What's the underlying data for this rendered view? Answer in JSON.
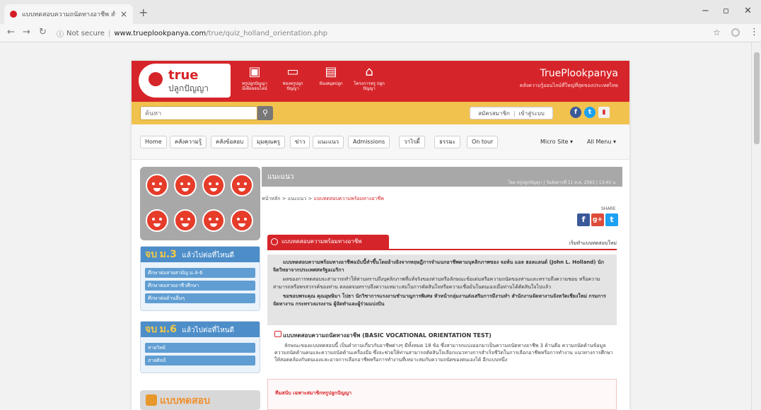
{
  "browser": {
    "tab_title": "แบบทดสอบความถนัดทางอาชีพ สำหรับ",
    "url_secure_label": "Not secure",
    "url_host": "www.trueplookpanya.com",
    "url_path": "/true/quiz_holland_orientation.php"
  },
  "header": {
    "logo_true": "true",
    "logo_sub": "ปลูกปัญญา",
    "brand_title": "TruePlookpanya",
    "brand_subtitle": "คลังความรู้ออนไลน์ที่ใหญ่ที่สุดของประเทศไทย",
    "nav": [
      {
        "label": "ทรูปลูกปัญญา มีเดียออนไลน์",
        "icon": "tv-icon"
      },
      {
        "label": "ช่องทรูปลูก ปัญญา",
        "icon": "monitor-icon"
      },
      {
        "label": "ห้องสมุดปลูก",
        "icon": "book-icon"
      },
      {
        "label": "โครงการทรู ปลูกปัญญา",
        "icon": "building-icon"
      }
    ]
  },
  "search": {
    "placeholder": "ค้นหา",
    "signup": "สมัครสมาชิก",
    "login": "เข้าสู่ระบบ"
  },
  "mainnav": {
    "items": [
      "Home",
      "คลังความรู้",
      "คลังข้อสอบ",
      "มุมคุณครู",
      "ข่าว",
      "แนะแนว",
      "Admissions",
      "วาไรตี้",
      "ธรรมะ",
      "On tour"
    ],
    "micro_site": "Micro Site ▾",
    "all_menu": "All Menu ▾"
  },
  "sidebar": {
    "grade3_big": "ม.3",
    "grade3_prefix": "จบ",
    "grade3_suffix": "แล้วไปต่อที่ไหนดี",
    "grade3_links": [
      "ศึกษาต่อสายสามัญ ม.4-6",
      "ศึกษาต่อสายอาชีวศึกษา",
      "ศึกษาต่อด้านอื่นๆ"
    ],
    "grade6_big": "ม.6",
    "grade6_prefix": "จบ",
    "grade6_suffix": "แล้วไปต่อที่ไหนดี",
    "grade6_links": [
      "สายวิทย์",
      "สายศิลป์"
    ],
    "quiz_label": "แบบทดสอบ"
  },
  "content": {
    "band_title": "แนะแนว",
    "band_date": "โดย ทรูปลูกปัญญา | วันอังคารที่ 11 ส.ค. 2563 | 13:45 น.",
    "crumbs_home": "หน้าหลัก",
    "crumbs_mid": "แนะแนว",
    "crumbs_current": "แบบทดสอบความพร้อมทางอาชีพ",
    "share_label": "SHARE",
    "section_tab": "แบบทดสอบความพร้อมทางอาชีพ",
    "restart": "เริ่มทำแบบทดสอบใหม่",
    "para1": "แบบทดสอบความพร้อมทางอาชีพฉบับนี้ทำขึ้นโดยอ้างอิงจากทฤษฎีการจำแนกอาชีพตามบุคลิกภาพของ จอห์น แอล ฮอลแลนด์ (John L. Holland) นักจิตวิทยาจากประเทศสหรัฐอเมริกา",
    "para2": "ผลของการทดสอบจะสามารถทำให้ท่านทราบถึงบุคลิกภาพที่แท้จริงของท่านหรือลักษณะข้อเด่นหรือความถนัดของท่านและทราบถึงความชอบ หรือความสามารถหรือพรสวรรค์ของท่าน ตลอดจนทราบถึงความเหมาะสมในการตัดสินใจหรือความเชื่อมั่นในตนเองเมื่อท่านได้ตัดสินใจไปแล้ว",
    "para3": "ขอขอบพระคุณ คุณอุษษิมา โปธา นักวิชาการแรงงานชำนาญการพิเศษ หัวหน้ากลุ่มงานส่งเสริมการมีงานทำ สำนักงานจัดหางานจังหวัดเชียงใหม่ กรมการจัดหางาน กระทรวงแรงงาน ผู้จัดทำและผู้ร่วมแบ่งปัน",
    "test_title": "แบบทดสอบความถนัดทางอาชีพ (BASIC VOCATIONAL ORIENTATION TEST)",
    "test_desc": "ลักษณะของแบบทดสอบนี้ เป็นคำถามเกี่ยวกับอาชีพต่างๆ มีทั้งหมด 18 ข้อ ซึ่งสามารถแบ่งออกมาเป็นความถนัดทางอาชีพ 3 ด้านคือ ความถนัดด้านข้อมูล ความถนัดด้านคนและความถนัดด้านเครื่องมือ ซึ่งจะช่วยให้ท่านสามารถตัดสินใจเลือกแนวทางการสำเร็จชีวิตในการเลือกอาชีพหรือการทำงาน แนวทางการศึกษาให้สอดคล้องกับตนเองและอาจการเลือกอาชีพหรือการทำงานที่เหมาะสมกับความถนัดของตนเองได้ อีกแบบหนึ่ง",
    "lower_text": "ทีมสนับ เฉพาะสมาชิกทรูปลูกปัญญา"
  },
  "colors": {
    "brand_red": "#d6252a",
    "brand_yellow": "#f2c24e",
    "grade_blue": "#4d8ec9"
  }
}
